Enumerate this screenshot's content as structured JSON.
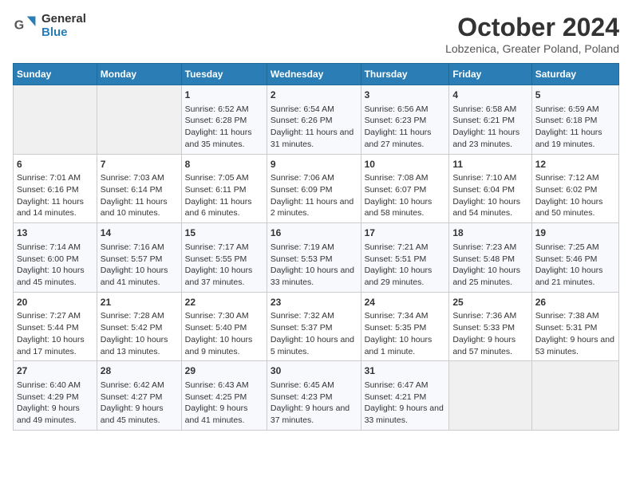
{
  "header": {
    "logo_general": "General",
    "logo_blue": "Blue",
    "month_title": "October 2024",
    "location": "Lobzenica, Greater Poland, Poland"
  },
  "days_of_week": [
    "Sunday",
    "Monday",
    "Tuesday",
    "Wednesday",
    "Thursday",
    "Friday",
    "Saturday"
  ],
  "weeks": [
    [
      {
        "day": "",
        "empty": true
      },
      {
        "day": "",
        "empty": true
      },
      {
        "day": "1",
        "sunrise": "Sunrise: 6:52 AM",
        "sunset": "Sunset: 6:28 PM",
        "daylight": "Daylight: 11 hours and 35 minutes."
      },
      {
        "day": "2",
        "sunrise": "Sunrise: 6:54 AM",
        "sunset": "Sunset: 6:26 PM",
        "daylight": "Daylight: 11 hours and 31 minutes."
      },
      {
        "day": "3",
        "sunrise": "Sunrise: 6:56 AM",
        "sunset": "Sunset: 6:23 PM",
        "daylight": "Daylight: 11 hours and 27 minutes."
      },
      {
        "day": "4",
        "sunrise": "Sunrise: 6:58 AM",
        "sunset": "Sunset: 6:21 PM",
        "daylight": "Daylight: 11 hours and 23 minutes."
      },
      {
        "day": "5",
        "sunrise": "Sunrise: 6:59 AM",
        "sunset": "Sunset: 6:18 PM",
        "daylight": "Daylight: 11 hours and 19 minutes."
      }
    ],
    [
      {
        "day": "6",
        "sunrise": "Sunrise: 7:01 AM",
        "sunset": "Sunset: 6:16 PM",
        "daylight": "Daylight: 11 hours and 14 minutes."
      },
      {
        "day": "7",
        "sunrise": "Sunrise: 7:03 AM",
        "sunset": "Sunset: 6:14 PM",
        "daylight": "Daylight: 11 hours and 10 minutes."
      },
      {
        "day": "8",
        "sunrise": "Sunrise: 7:05 AM",
        "sunset": "Sunset: 6:11 PM",
        "daylight": "Daylight: 11 hours and 6 minutes."
      },
      {
        "day": "9",
        "sunrise": "Sunrise: 7:06 AM",
        "sunset": "Sunset: 6:09 PM",
        "daylight": "Daylight: 11 hours and 2 minutes."
      },
      {
        "day": "10",
        "sunrise": "Sunrise: 7:08 AM",
        "sunset": "Sunset: 6:07 PM",
        "daylight": "Daylight: 10 hours and 58 minutes."
      },
      {
        "day": "11",
        "sunrise": "Sunrise: 7:10 AM",
        "sunset": "Sunset: 6:04 PM",
        "daylight": "Daylight: 10 hours and 54 minutes."
      },
      {
        "day": "12",
        "sunrise": "Sunrise: 7:12 AM",
        "sunset": "Sunset: 6:02 PM",
        "daylight": "Daylight: 10 hours and 50 minutes."
      }
    ],
    [
      {
        "day": "13",
        "sunrise": "Sunrise: 7:14 AM",
        "sunset": "Sunset: 6:00 PM",
        "daylight": "Daylight: 10 hours and 45 minutes."
      },
      {
        "day": "14",
        "sunrise": "Sunrise: 7:16 AM",
        "sunset": "Sunset: 5:57 PM",
        "daylight": "Daylight: 10 hours and 41 minutes."
      },
      {
        "day": "15",
        "sunrise": "Sunrise: 7:17 AM",
        "sunset": "Sunset: 5:55 PM",
        "daylight": "Daylight: 10 hours and 37 minutes."
      },
      {
        "day": "16",
        "sunrise": "Sunrise: 7:19 AM",
        "sunset": "Sunset: 5:53 PM",
        "daylight": "Daylight: 10 hours and 33 minutes."
      },
      {
        "day": "17",
        "sunrise": "Sunrise: 7:21 AM",
        "sunset": "Sunset: 5:51 PM",
        "daylight": "Daylight: 10 hours and 29 minutes."
      },
      {
        "day": "18",
        "sunrise": "Sunrise: 7:23 AM",
        "sunset": "Sunset: 5:48 PM",
        "daylight": "Daylight: 10 hours and 25 minutes."
      },
      {
        "day": "19",
        "sunrise": "Sunrise: 7:25 AM",
        "sunset": "Sunset: 5:46 PM",
        "daylight": "Daylight: 10 hours and 21 minutes."
      }
    ],
    [
      {
        "day": "20",
        "sunrise": "Sunrise: 7:27 AM",
        "sunset": "Sunset: 5:44 PM",
        "daylight": "Daylight: 10 hours and 17 minutes."
      },
      {
        "day": "21",
        "sunrise": "Sunrise: 7:28 AM",
        "sunset": "Sunset: 5:42 PM",
        "daylight": "Daylight: 10 hours and 13 minutes."
      },
      {
        "day": "22",
        "sunrise": "Sunrise: 7:30 AM",
        "sunset": "Sunset: 5:40 PM",
        "daylight": "Daylight: 10 hours and 9 minutes."
      },
      {
        "day": "23",
        "sunrise": "Sunrise: 7:32 AM",
        "sunset": "Sunset: 5:37 PM",
        "daylight": "Daylight: 10 hours and 5 minutes."
      },
      {
        "day": "24",
        "sunrise": "Sunrise: 7:34 AM",
        "sunset": "Sunset: 5:35 PM",
        "daylight": "Daylight: 10 hours and 1 minute."
      },
      {
        "day": "25",
        "sunrise": "Sunrise: 7:36 AM",
        "sunset": "Sunset: 5:33 PM",
        "daylight": "Daylight: 9 hours and 57 minutes."
      },
      {
        "day": "26",
        "sunrise": "Sunrise: 7:38 AM",
        "sunset": "Sunset: 5:31 PM",
        "daylight": "Daylight: 9 hours and 53 minutes."
      }
    ],
    [
      {
        "day": "27",
        "sunrise": "Sunrise: 6:40 AM",
        "sunset": "Sunset: 4:29 PM",
        "daylight": "Daylight: 9 hours and 49 minutes."
      },
      {
        "day": "28",
        "sunrise": "Sunrise: 6:42 AM",
        "sunset": "Sunset: 4:27 PM",
        "daylight": "Daylight: 9 hours and 45 minutes."
      },
      {
        "day": "29",
        "sunrise": "Sunrise: 6:43 AM",
        "sunset": "Sunset: 4:25 PM",
        "daylight": "Daylight: 9 hours and 41 minutes."
      },
      {
        "day": "30",
        "sunrise": "Sunrise: 6:45 AM",
        "sunset": "Sunset: 4:23 PM",
        "daylight": "Daylight: 9 hours and 37 minutes."
      },
      {
        "day": "31",
        "sunrise": "Sunrise: 6:47 AM",
        "sunset": "Sunset: 4:21 PM",
        "daylight": "Daylight: 9 hours and 33 minutes."
      },
      {
        "day": "",
        "empty": true
      },
      {
        "day": "",
        "empty": true
      }
    ]
  ]
}
